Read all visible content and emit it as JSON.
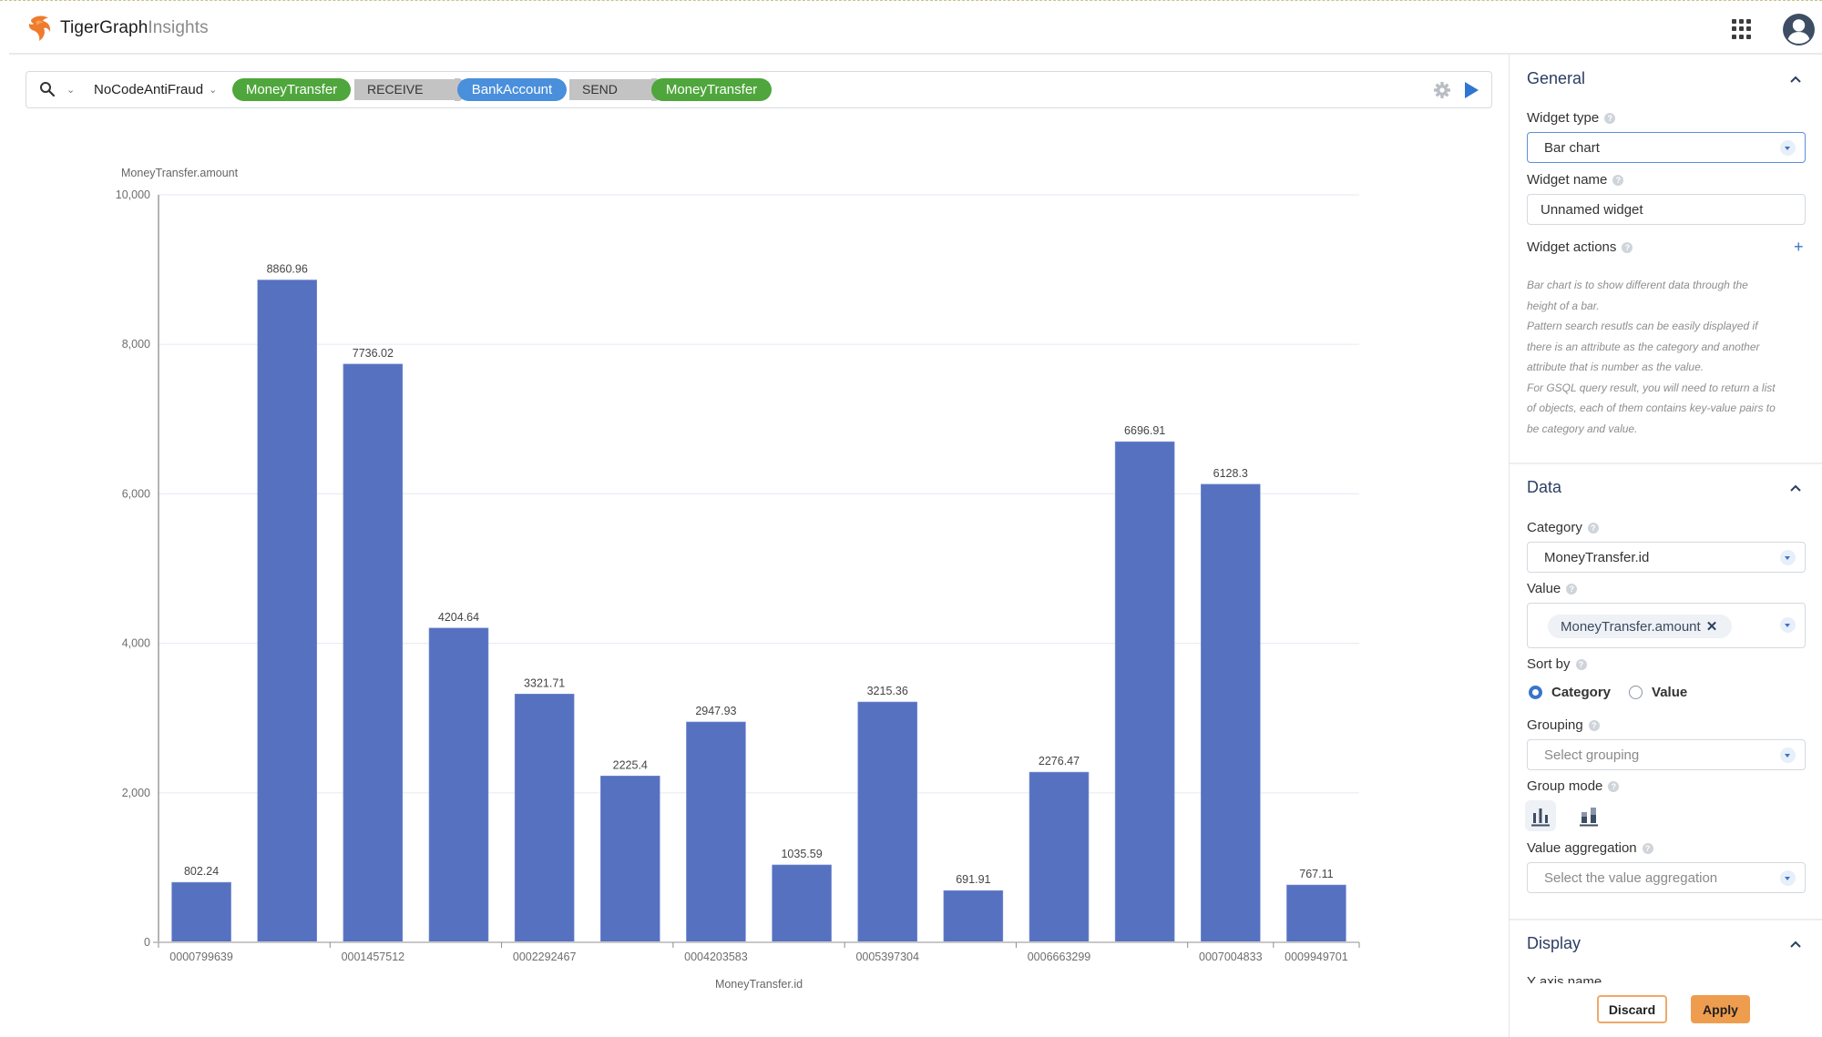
{
  "app": {
    "brand": "TigerGraph",
    "product": "Insights",
    "icons": {
      "logo": "tiger-logo-icon",
      "apps": "apps-grid-icon",
      "account": "user-avatar-icon"
    }
  },
  "query_bar": {
    "search_icon": "search-icon",
    "graph_name": "NoCodeAntiFraud",
    "pattern": [
      {
        "kind": "vertex",
        "label": "MoneyTransfer",
        "color": "#4fa63c"
      },
      {
        "kind": "edge",
        "label": "RECEIVE"
      },
      {
        "kind": "vertex",
        "label": "BankAccount",
        "color": "#4a8fdc"
      },
      {
        "kind": "edge",
        "label": "SEND"
      },
      {
        "kind": "vertex",
        "label": "MoneyTransfer",
        "color": "#4fa63c"
      }
    ],
    "settings_icon": "gear-icon",
    "run_icon": "play-icon"
  },
  "chart_data": {
    "type": "bar",
    "title": "",
    "xlabel": "MoneyTransfer.id",
    "ylabel": "MoneyTransfer.amount",
    "ylim": [
      0,
      10000
    ],
    "yticks": [
      0,
      2000,
      4000,
      6000,
      8000,
      10000
    ],
    "ytick_labels": [
      "0",
      "2,000",
      "4,000",
      "6,000",
      "8,000",
      "10,000"
    ],
    "grid": true,
    "bar_color": "#5671c0",
    "categories": [
      "0000799639",
      "",
      "0001457512",
      "",
      "0002292467",
      "",
      "0004203583",
      "",
      "0005397304",
      "",
      "0006663299",
      "",
      "0007004833",
      "0009949701"
    ],
    "values": [
      802.24,
      8860.96,
      7736.02,
      4204.64,
      3321.71,
      2225.4,
      2947.93,
      1035.59,
      3215.36,
      691.91,
      2276.47,
      6696.91,
      6128.3,
      767.11
    ],
    "data_labels": [
      "802.24",
      "8860.96",
      "7736.02",
      "4204.64",
      "3321.71",
      "2225.4",
      "2947.93",
      "1035.59",
      "3215.36",
      "691.91",
      "2276.47",
      "6696.91",
      "6128.3",
      "767.11"
    ],
    "visible_tick_label_indices": [
      0,
      2,
      4,
      6,
      8,
      10,
      12,
      13
    ]
  },
  "panel": {
    "general": {
      "title": "General",
      "widget_type_label": "Widget type",
      "widget_type_value": "Bar chart",
      "widget_name_label": "Widget name",
      "widget_name_value": "Unnamed widget",
      "widget_actions_label": "Widget actions",
      "description": [
        "Bar chart is to show different data through the",
        "height of a bar.",
        "Pattern search resutls can be easily displayed if",
        "there is an attribute as the category and another",
        "attribute that is number as the value.",
        "For GSQL query result, you will need to return a list",
        "of objects, each of them contains key-value pairs to",
        "be category and value."
      ]
    },
    "data": {
      "title": "Data",
      "category_label": "Category",
      "category_value": "MoneyTransfer.id",
      "value_label": "Value",
      "value_chip": "MoneyTransfer.amount",
      "sort_by_label": "Sort by",
      "sort_options": [
        "Category",
        "Value"
      ],
      "sort_selected": "Category",
      "grouping_label": "Grouping",
      "grouping_placeholder": "Select grouping",
      "group_mode_label": "Group mode",
      "group_modes": [
        "grouped-bars",
        "stacked-bars"
      ],
      "group_mode_selected": "grouped-bars",
      "aggregation_label": "Value aggregation",
      "aggregation_placeholder": "Select the value aggregation"
    },
    "display": {
      "title": "Display",
      "first_label_partial": "Y axis name"
    },
    "buttons": {
      "discard": "Discard",
      "apply": "Apply"
    }
  }
}
